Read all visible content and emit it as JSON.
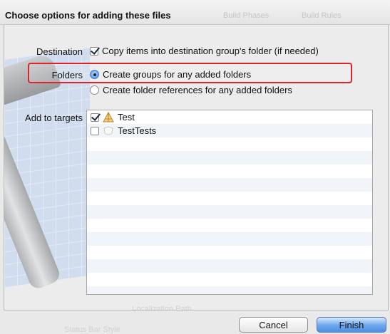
{
  "dialog": {
    "title": "Choose options for adding these files",
    "ghost_tabs": [
      "Build Phases",
      "Build Rules"
    ]
  },
  "destination": {
    "label": "Destination",
    "checkbox_label": "Copy items into destination group's folder (if needed)",
    "checked": true,
    "highlight_color": "#d9262d"
  },
  "folders": {
    "label": "Folders",
    "options": [
      {
        "label": "Create groups for any added folders",
        "selected": true
      },
      {
        "label": "Create folder references for any added folders",
        "selected": false
      }
    ]
  },
  "targets": {
    "label": "Add to targets",
    "items": [
      {
        "name": "Test",
        "checked": true,
        "icon": "app-target-icon"
      },
      {
        "name": "TestTests",
        "checked": false,
        "icon": "test-target-icon"
      }
    ]
  },
  "buttons": {
    "cancel": "Cancel",
    "finish": "Finish",
    "finish_color": "#4b8fe3"
  },
  "ghost_bottom": {
    "text_1": "Localization Path",
    "text_2": "Status Bar Style"
  }
}
